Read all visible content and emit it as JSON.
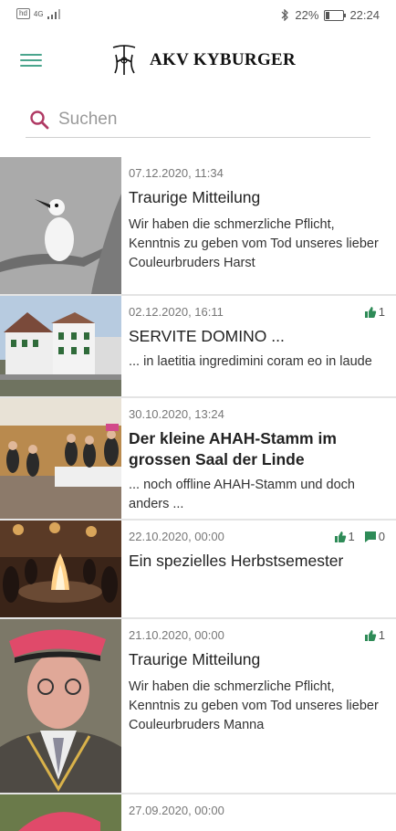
{
  "status": {
    "carrier": "hd",
    "net": "4G",
    "battery": "22%",
    "time": "22:24",
    "battery_level": 0.22
  },
  "header": {
    "title": "AKV KYBURGER",
    "logo_monogram": "AKV"
  },
  "search": {
    "placeholder": "Suchen"
  },
  "colors": {
    "accent": "#4aa58d",
    "search_icon": "#b03a64",
    "like": "#2e8b57"
  },
  "posts": [
    {
      "date": "07.12.2020, 11:34",
      "title": "Traurige Mitteilung",
      "excerpt": "Wir haben die schmerzliche Pflicht, Kenntnis zu geben vom Tod unseres lieber Couleurbruders Harst",
      "likes": null,
      "comments": null,
      "image": "bird"
    },
    {
      "date": "02.12.2020, 16:11",
      "title": "SERVITE DOMINO ...",
      "excerpt": "... in laetitia ingredimini coram eo in laude",
      "likes": "1",
      "comments": null,
      "image": "building"
    },
    {
      "date": "30.10.2020, 13:24",
      "title": "Der kleine AHAH-Stamm im grossen Saal der Linde",
      "excerpt": "... noch offline AHAH-Stamm und doch anders ...",
      "likes": null,
      "comments": null,
      "image": "hall"
    },
    {
      "date": "22.10.2020, 00:00",
      "title": "Ein spezielles Herbstsemester",
      "excerpt": "",
      "likes": "1",
      "comments": "0",
      "image": "fire"
    },
    {
      "date": "21.10.2020, 00:00",
      "title": "Traurige Mitteilung",
      "excerpt": "Wir haben die schmerzliche Pflicht, Kenntnis zu geben vom Tod unseres lieber Couleurbruders Manna",
      "likes": "1",
      "comments": null,
      "image": "portrait"
    },
    {
      "date": "27.09.2020, 00:00",
      "title": "",
      "excerpt": "",
      "likes": null,
      "comments": null,
      "image": "partial"
    }
  ]
}
